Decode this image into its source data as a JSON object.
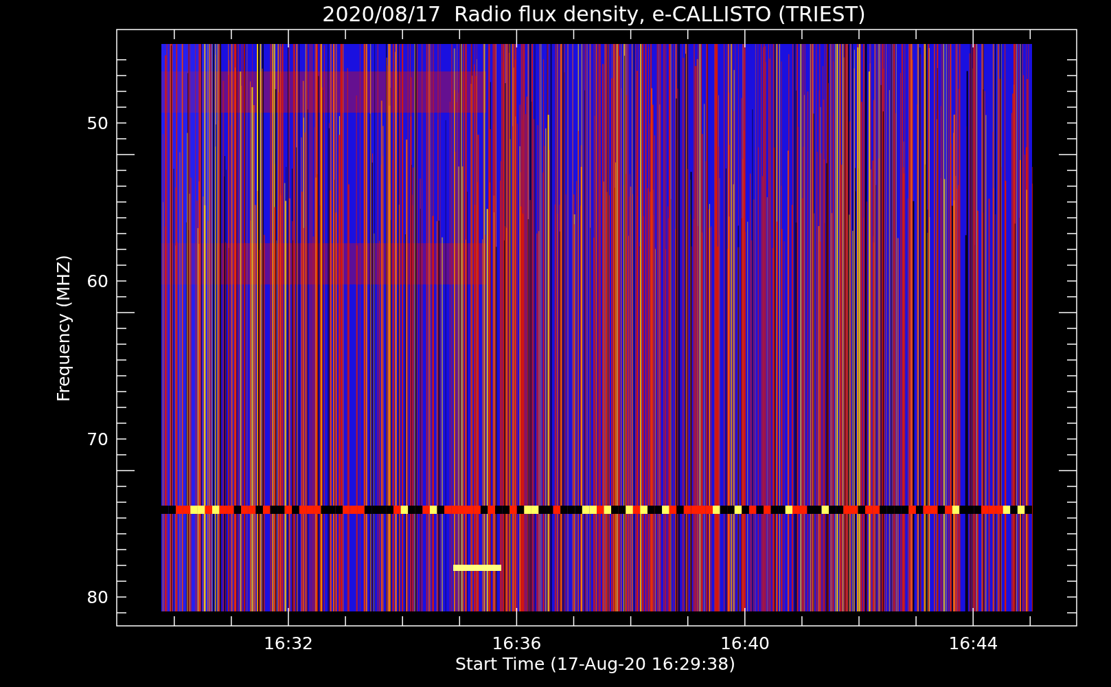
{
  "title": "2020/08/17  Radio flux density, e-CALLISTO (TRIEST)",
  "y_axis": {
    "label": "Frequency (MHZ)",
    "ticks": [
      "50",
      "60",
      "70",
      "80"
    ]
  },
  "x_axis": {
    "label": "Start Time (17-Aug-20 16:29:38)",
    "ticks": [
      "16:32",
      "16:36",
      "16:40",
      "16:44"
    ]
  }
}
